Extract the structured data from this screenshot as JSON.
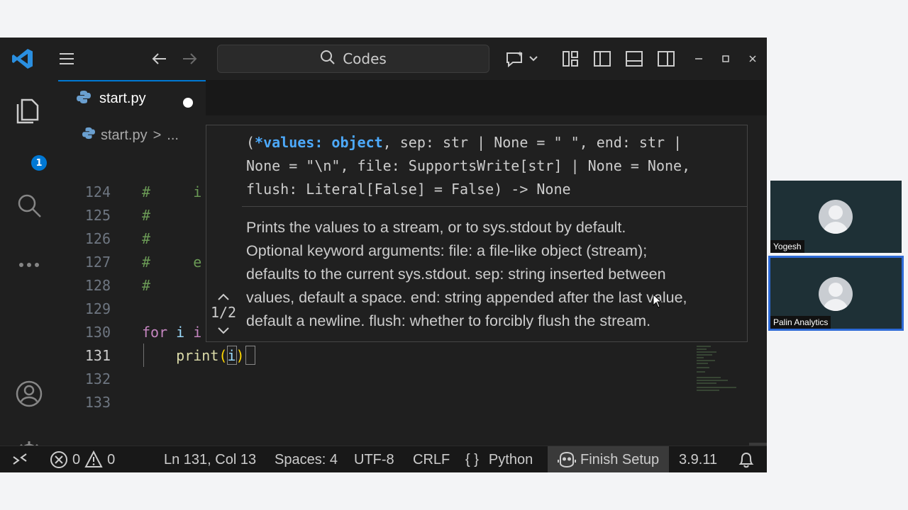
{
  "window": {
    "search_label": "Codes"
  },
  "activity_bar": {
    "explorer_badge": "1"
  },
  "tabs": [
    {
      "label": "start.py",
      "dirty": true
    }
  ],
  "breadcrumb": {
    "file": "start.py",
    "separator": ">",
    "ellipsis": "..."
  },
  "editor": {
    "lines": [
      {
        "number": "124",
        "code": "#     i"
      },
      {
        "number": "125",
        "code": "#"
      },
      {
        "number": "126",
        "code": "#"
      },
      {
        "number": "127",
        "code": "#     e"
      },
      {
        "number": "128",
        "code": "#"
      },
      {
        "number": "129",
        "code": ""
      },
      {
        "number": "130",
        "code": "for i i"
      },
      {
        "number": "131",
        "code": "    print(i)"
      },
      {
        "number": "132",
        "code": ""
      },
      {
        "number": "133",
        "code": ""
      }
    ]
  },
  "hover": {
    "signature_highlight": "*values: object",
    "signature_line1_prefix": "(",
    "signature_line1_rest": ", sep: str | None = \" \", end: str |",
    "signature_line2": "None = \"\\n\", file: SupportsWrite[str] | None = None,",
    "signature_line3": "flush: Literal[False] = False) -> None",
    "doc_lines": [
      "Prints the values to a stream, or to sys.stdout by default.",
      "Optional keyword arguments: file: a file-like object (stream);",
      "defaults to the current sys.stdout. sep: string inserted between",
      "values, default a space. end: string appended after the last value,",
      "default a newline. flush: whether to forcibly flush the stream."
    ],
    "overload": "1/2"
  },
  "status_bar": {
    "errors": "0",
    "warnings": "0",
    "position": "Ln 131, Col 13",
    "spaces": "Spaces: 4",
    "encoding": "UTF-8",
    "eol": "CRLF",
    "language_braces": "{ }",
    "language": "Python",
    "finish_setup": "Finish Setup",
    "python_version": "3.9.11"
  },
  "participants": [
    {
      "name": "Yogesh",
      "active": false
    },
    {
      "name": "Palin Analytics",
      "active": true
    }
  ],
  "colors": {
    "accent": "#0078d4",
    "keyword": "#c586c0",
    "function": "#dcdcaa",
    "variable": "#9cdcfe",
    "comment": "#6a9955",
    "hover_highlight": "#4daafc"
  }
}
